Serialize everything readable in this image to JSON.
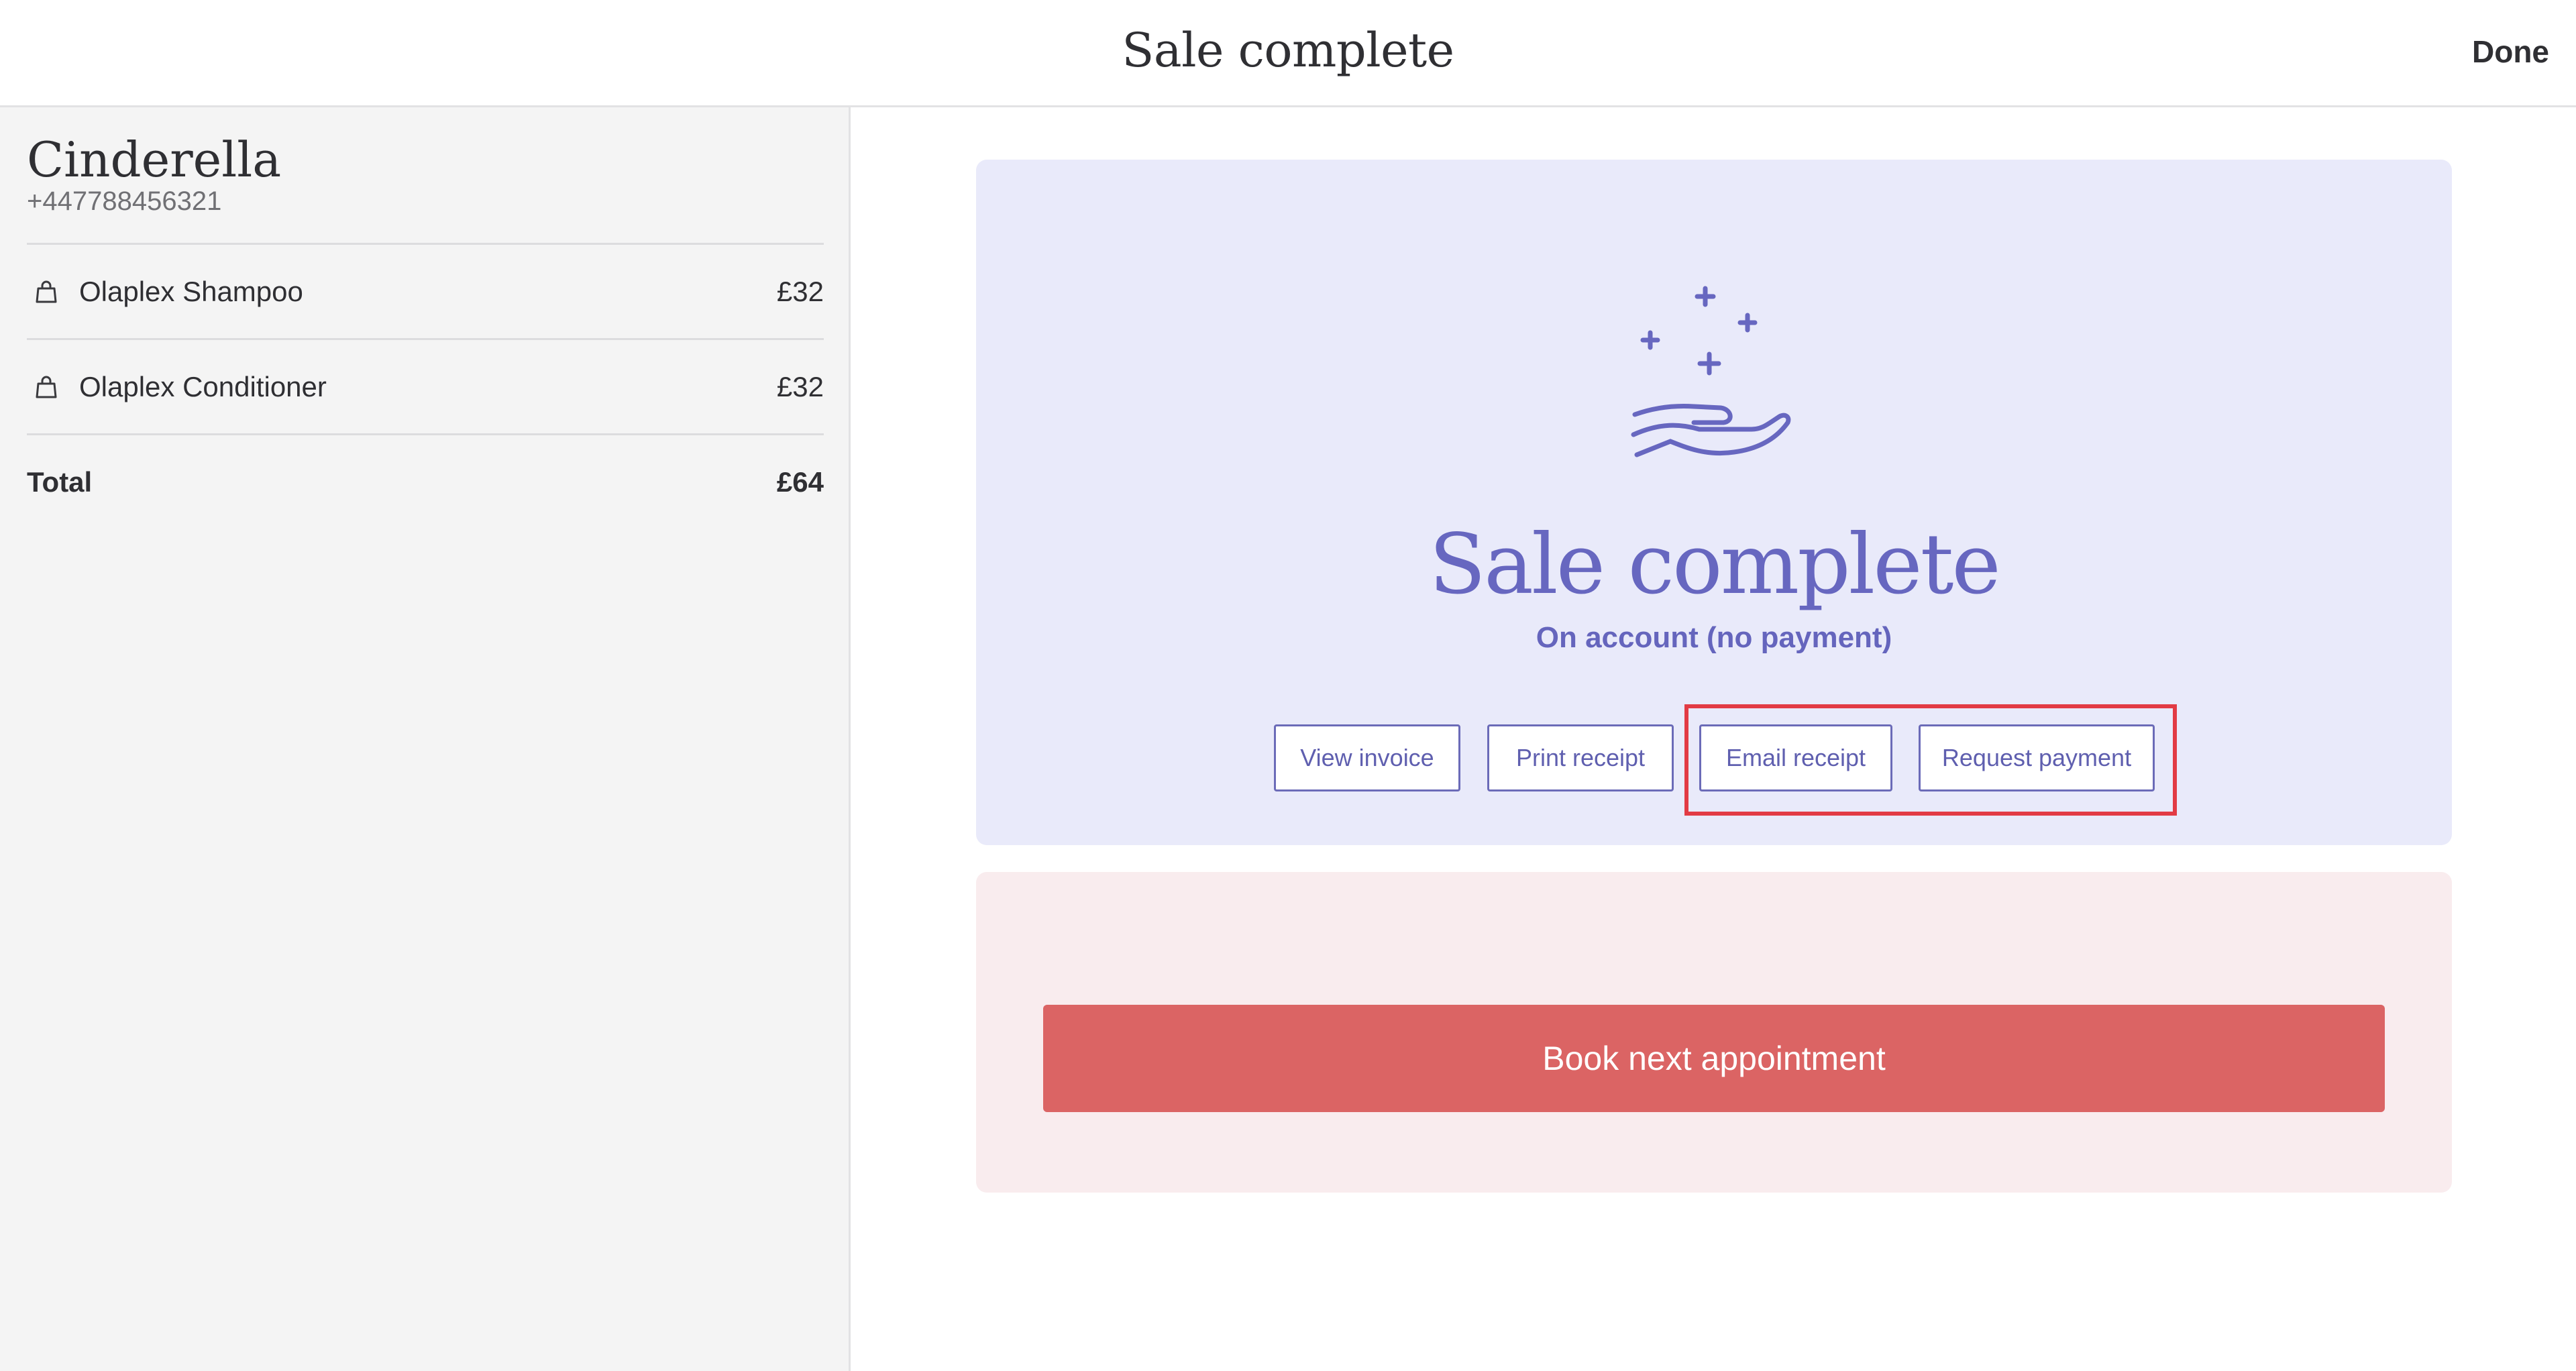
{
  "header": {
    "title": "Sale complete",
    "done_label": "Done"
  },
  "client": {
    "name": "Cinderella",
    "phone": "+447788456321"
  },
  "items": [
    {
      "icon": "shopping-bag-icon",
      "label": "Olaplex Shampoo",
      "price": "£32"
    },
    {
      "icon": "shopping-bag-icon",
      "label": "Olaplex Conditioner",
      "price": "£32"
    }
  ],
  "total": {
    "label": "Total",
    "value": "£64"
  },
  "success": {
    "icon": "hand-with-sparkles-icon",
    "title": "Sale complete",
    "subtitle": "On account (no payment)",
    "actions": {
      "view_invoice": "View invoice",
      "print_receipt": "Print receipt",
      "email_receipt": "Email receipt",
      "request_payment": "Request payment"
    }
  },
  "booking": {
    "button_label": "Book next appointment"
  },
  "colors": {
    "accent": "#6767c0",
    "success_panel_bg": "#e9eafa",
    "booking_panel_bg": "#f9ecee",
    "primary_button": "#db6464",
    "highlight": "#e23b44",
    "sidebar_bg": "#f4f4f4"
  }
}
